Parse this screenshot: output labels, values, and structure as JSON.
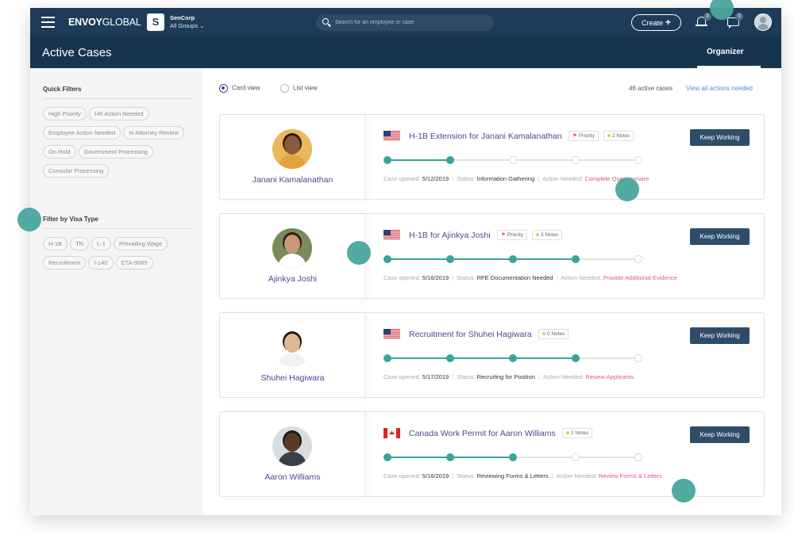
{
  "header": {
    "brand_bold": "ENVOY",
    "brand_light": "GLOBAL",
    "company_initial": "S",
    "company_name": "SenCorp",
    "company_group": "All Groups ⌄",
    "search_placeholder": "Search for an employee or case",
    "create_label": "Create",
    "notifications_count": "3",
    "messages_count": "3"
  },
  "subheader": {
    "title": "Active Cases",
    "tab": "Organizer"
  },
  "sidebar": {
    "quick_filters_title": "Quick Filters",
    "quick_filters": [
      "High Priority",
      "HR Action Needed",
      "Employee Action Needed",
      "In Attorney Review",
      "On Hold",
      "Government Processing",
      "Consular Processing"
    ],
    "visa_title": "Filter by Visa Type",
    "visa_types": [
      "H-1B",
      "TN",
      "L-1",
      "Prevailing Wage",
      "Recruitment",
      "I-140",
      "ETA-9089"
    ]
  },
  "main": {
    "card_view_label": "Card view",
    "list_view_label": "List view",
    "selected_view": "card",
    "active_count_text": "46 active cases",
    "view_all_label": "View all actions needed",
    "labels": {
      "case_opened": "Case opened:",
      "status": "Status:",
      "action_needed": "Action Needed:",
      "keep_working": "Keep Working"
    }
  },
  "cases": [
    {
      "name": "Janani Kamalanathan",
      "flag": "us",
      "title": "H-1B Extension for Janani Kamalanathan",
      "priority": "Priority",
      "notes": "2 Notes",
      "opened": "5/12/2019",
      "status": "Information Gathering",
      "action": "Complete Questionnaire",
      "progress_completed": 2,
      "progress_total": 5,
      "skin": "#8a5a3c",
      "hair": "#2a1a12",
      "shirt": "#e2a33a",
      "bg": "#e8b85a"
    },
    {
      "name": "Ajinkya Joshi",
      "flag": "us",
      "title": "H-1B for Ajinkya Joshi",
      "priority": "Priority",
      "notes": "3 Notes",
      "opened": "5/16/2019",
      "status": "RFE Documentation Needed",
      "action": "Provide Additional Evidence",
      "progress_completed": 4,
      "progress_total": 5,
      "skin": "#c99877",
      "hair": "#2b1d16",
      "shirt": "#ffffff",
      "bg": "#7a8a5a"
    },
    {
      "name": "Shuhei Hagiwara",
      "flag": "us",
      "title": "Recruitment for Shuhei Hagiwara",
      "priority": "",
      "notes": "0 Notes",
      "opened": "5/17/2019",
      "status": "Recruiting for Position",
      "action": "Review Applicants",
      "progress_completed": 4,
      "progress_total": 5,
      "skin": "#e0b894",
      "hair": "#1b1b1b",
      "shirt": "#f2f2f2",
      "bg": "#ffffff"
    },
    {
      "name": "Aaron Williams",
      "flag": "ca",
      "title": "Canada Work Permit for Aaron Williams",
      "priority": "",
      "notes": "2 Notes",
      "opened": "5/16/2019",
      "status": "Reviewing Forms & Letters",
      "action": "Review Forms & Letters",
      "progress_completed": 3,
      "progress_total": 5,
      "skin": "#5a3a26",
      "hair": "#1a1a1a",
      "shirt": "#3a3f48",
      "bg": "#d8dde2"
    }
  ],
  "colors": {
    "header_bg": "#1e3c58",
    "subheader_bg": "#17344f",
    "accent_purple": "#5a3f8f",
    "progress_teal": "#3aa39b",
    "action_red": "#e5557a",
    "button_navy": "#2e4d69",
    "hint_dot": "#4aa59d"
  }
}
